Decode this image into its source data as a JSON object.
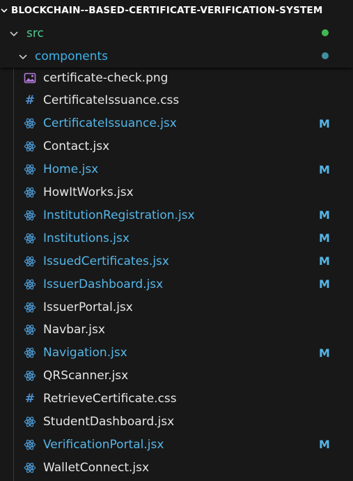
{
  "explorer": {
    "project_title": "BLOCKCHAIN--BASED-CERTIFICATE-VERIFICATION-SYSTEM",
    "folders": {
      "src": "src",
      "components": "components"
    },
    "colors": {
      "src_dot": "#3fb950",
      "components_dot": "#3f8f9f",
      "modified": "#56b6e8",
      "react_icon": "#4ea0dc",
      "css_icon": "#4f8fd0",
      "image_icon": "#b07ad6"
    },
    "files": [
      {
        "name": "certificate-check.png",
        "icon": "image-icon",
        "modified": false,
        "badge": ""
      },
      {
        "name": "CertificateIssuance.css",
        "icon": "css-hash-icon",
        "modified": false,
        "badge": ""
      },
      {
        "name": "CertificateIssuance.jsx",
        "icon": "react-icon",
        "modified": true,
        "badge": "M"
      },
      {
        "name": "Contact.jsx",
        "icon": "react-icon",
        "modified": false,
        "badge": ""
      },
      {
        "name": "Home.jsx",
        "icon": "react-icon",
        "modified": true,
        "badge": "M"
      },
      {
        "name": "HowItWorks.jsx",
        "icon": "react-icon",
        "modified": false,
        "badge": ""
      },
      {
        "name": "InstitutionRegistration.jsx",
        "icon": "react-icon",
        "modified": true,
        "badge": "M"
      },
      {
        "name": "Institutions.jsx",
        "icon": "react-icon",
        "modified": true,
        "badge": "M"
      },
      {
        "name": "IssuedCertificates.jsx",
        "icon": "react-icon",
        "modified": true,
        "badge": "M"
      },
      {
        "name": "IssuerDashboard.jsx",
        "icon": "react-icon",
        "modified": true,
        "badge": "M"
      },
      {
        "name": "IssuerPortal.jsx",
        "icon": "react-icon",
        "modified": false,
        "badge": ""
      },
      {
        "name": "Navbar.jsx",
        "icon": "react-icon",
        "modified": false,
        "badge": ""
      },
      {
        "name": "Navigation.jsx",
        "icon": "react-icon",
        "modified": true,
        "badge": "M"
      },
      {
        "name": "QRScanner.jsx",
        "icon": "react-icon",
        "modified": false,
        "badge": ""
      },
      {
        "name": "RetrieveCertificate.css",
        "icon": "css-hash-icon",
        "modified": false,
        "badge": ""
      },
      {
        "name": "StudentDashboard.jsx",
        "icon": "react-icon",
        "modified": false,
        "badge": ""
      },
      {
        "name": "VerificationPortal.jsx",
        "icon": "react-icon",
        "modified": true,
        "badge": "M"
      },
      {
        "name": "WalletConnect.jsx",
        "icon": "react-icon",
        "modified": false,
        "badge": ""
      }
    ]
  }
}
